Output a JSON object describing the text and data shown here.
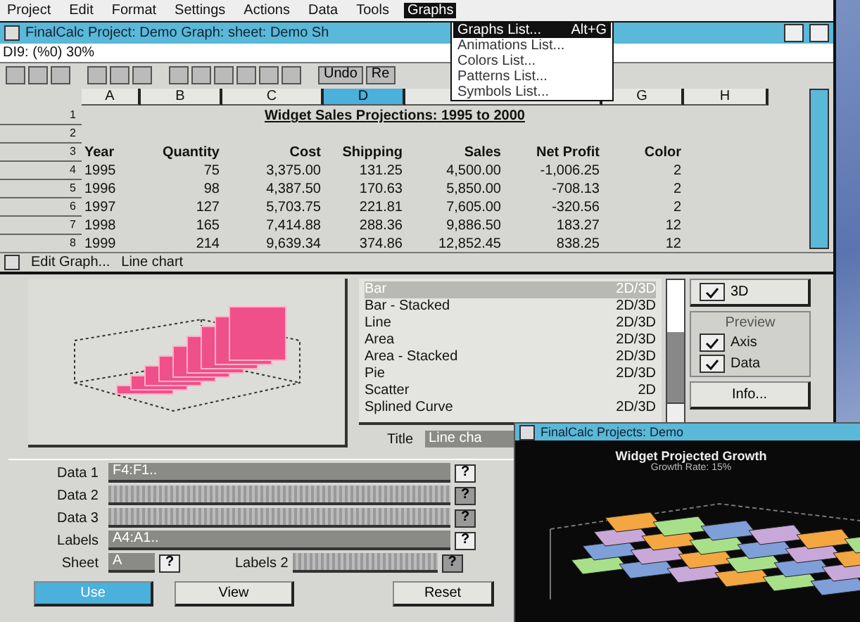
{
  "menu": [
    {
      "label": "Project",
      "selected": false
    },
    {
      "label": "Edit",
      "selected": false
    },
    {
      "label": "Format",
      "selected": false
    },
    {
      "label": "Settings",
      "selected": false
    },
    {
      "label": "Actions",
      "selected": false
    },
    {
      "label": "Data",
      "selected": false
    },
    {
      "label": "Tools",
      "selected": false
    },
    {
      "label": "Graphs",
      "selected": true
    }
  ],
  "graphs_menu": [
    {
      "label": "Graphs List...",
      "shortcut": "Alt+G",
      "selected": true
    },
    {
      "label": "Animations List...",
      "selected": false
    },
    {
      "label": "Colors List...",
      "selected": false
    },
    {
      "label": "Patterns List...",
      "selected": false
    },
    {
      "label": "Symbols List...",
      "selected": false
    }
  ],
  "window": {
    "title": "FinalCalc Project: Demo Graph: sheet: Demo Sh"
  },
  "cell_ref": "DI9: (%0) 30%",
  "toolbar": {
    "buttons": [
      "Undo",
      "Re"
    ]
  },
  "columns": [
    {
      "label": "A",
      "selected": false
    },
    {
      "label": "B",
      "selected": false
    },
    {
      "label": "C",
      "selected": false
    },
    {
      "label": "D",
      "selected": true
    },
    {
      "label": "G",
      "selected": false
    },
    {
      "label": "H",
      "selected": false
    }
  ],
  "rows": [
    {
      "number": "1",
      "title": "Widget Sales Projections: 1995 to 2000"
    },
    {
      "number": "2",
      "cells": []
    },
    {
      "number": "3",
      "cells": [
        "Year",
        "Quantity",
        "Cost",
        "Shipping",
        "Sales",
        "Net Profit",
        "Color"
      ]
    },
    {
      "number": "4",
      "cells": [
        "1995",
        "75",
        "3,375.00",
        "131.25",
        "4,500.00",
        "-1,006.25",
        "2"
      ]
    },
    {
      "number": "5",
      "cells": [
        "1996",
        "98",
        "4,387.50",
        "170.63",
        "5,850.00",
        "-708.13",
        "2"
      ]
    },
    {
      "number": "6",
      "cells": [
        "1997",
        "127",
        "5,703.75",
        "221.81",
        "7,605.00",
        "-320.56",
        "2"
      ]
    },
    {
      "number": "7",
      "cells": [
        "1998",
        "165",
        "7,414.88",
        "288.36",
        "9,886.50",
        "183.27",
        "12"
      ]
    },
    {
      "number": "8",
      "cells": [
        "1999",
        "214",
        "9,639.34",
        "374.86",
        "12,852.45",
        "838.25",
        "12"
      ]
    }
  ],
  "status_bar": [
    "Edit Graph...",
    "Line chart"
  ],
  "chart_types": [
    {
      "name": "Bar",
      "dims": "2D/3D",
      "selected": true
    },
    {
      "name": "Bar - Stacked",
      "dims": "2D/3D",
      "selected": false
    },
    {
      "name": "Line",
      "dims": "2D/3D",
      "selected": false
    },
    {
      "name": "Area",
      "dims": "2D/3D",
      "selected": false
    },
    {
      "name": "Area - Stacked",
      "dims": "2D/3D",
      "selected": false
    },
    {
      "name": "Pie",
      "dims": "2D/3D",
      "selected": false
    },
    {
      "name": "Scatter",
      "dims": "2D",
      "selected": false
    },
    {
      "name": "Splined Curve",
      "dims": "2D/3D",
      "selected": false
    }
  ],
  "options": {
    "three_d": {
      "label": "3D",
      "checked": true
    },
    "preview_label": "Preview",
    "axis": {
      "label": "Axis",
      "checked": true
    },
    "data": {
      "label": "Data",
      "checked": true
    },
    "info": "Info..."
  },
  "title_field": {
    "label": "Title",
    "value": "Line cha"
  },
  "ranges": [
    {
      "label": "Data 1",
      "value": "F4:F1..",
      "disabled": false,
      "help": "?"
    },
    {
      "label": "Data 2",
      "disabled": true,
      "help": "?"
    },
    {
      "label": "Data 3",
      "disabled": true,
      "help": "?"
    },
    {
      "label": "Labels",
      "value": "A4:A1..",
      "disabled": false,
      "help": "?"
    }
  ],
  "sheet": {
    "label": "Sheet",
    "value": "A",
    "help": "?"
  },
  "labels2": {
    "label": "Labels 2",
    "disabled": true,
    "help": "?"
  },
  "buttons": [
    {
      "label": "Use",
      "selected": true
    },
    {
      "label": "View",
      "selected": false
    },
    {
      "label": "Reset",
      "selected": false
    }
  ],
  "graph_window": {
    "title": "FinalCalc Projects: Demo",
    "chart_title": "Widget Projected Growth",
    "subtitle": "Growth Rate: 15%"
  }
}
